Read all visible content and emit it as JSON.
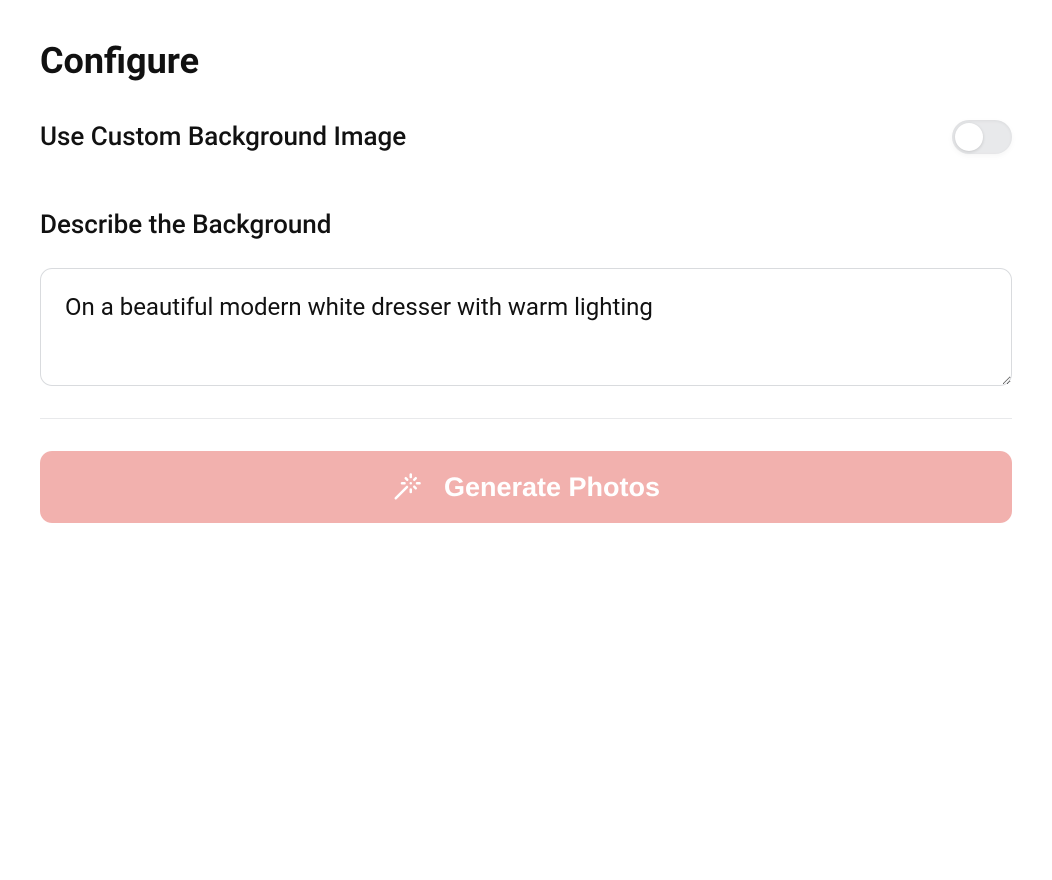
{
  "page": {
    "title": "Configure"
  },
  "options": {
    "custom_bg_label": "Use Custom Background Image",
    "custom_bg_enabled": false
  },
  "describe": {
    "label": "Describe the Background",
    "value": "On a beautiful modern white dresser with warm lighting"
  },
  "actions": {
    "generate_label": "Generate Photos"
  },
  "colors": {
    "button_bg": "#f2b1ae",
    "button_text": "#ffffff"
  }
}
